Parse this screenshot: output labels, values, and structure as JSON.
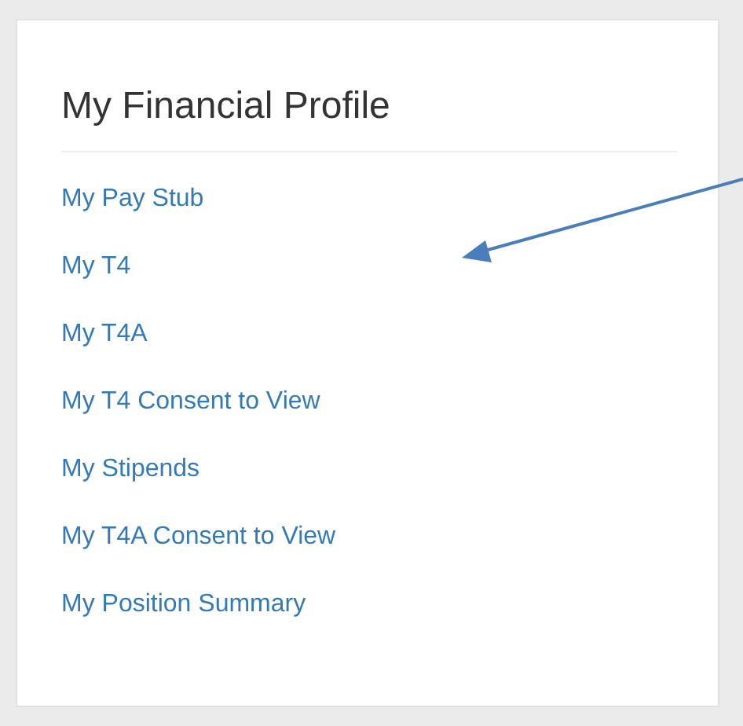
{
  "panel": {
    "title": "My Financial Profile",
    "links": [
      {
        "label": "My Pay Stub"
      },
      {
        "label": "My T4"
      },
      {
        "label": "My T4A"
      },
      {
        "label": "My T4 Consent to View"
      },
      {
        "label": "My Stipends"
      },
      {
        "label": "My T4A Consent to View"
      },
      {
        "label": "My Position Summary"
      }
    ]
  }
}
